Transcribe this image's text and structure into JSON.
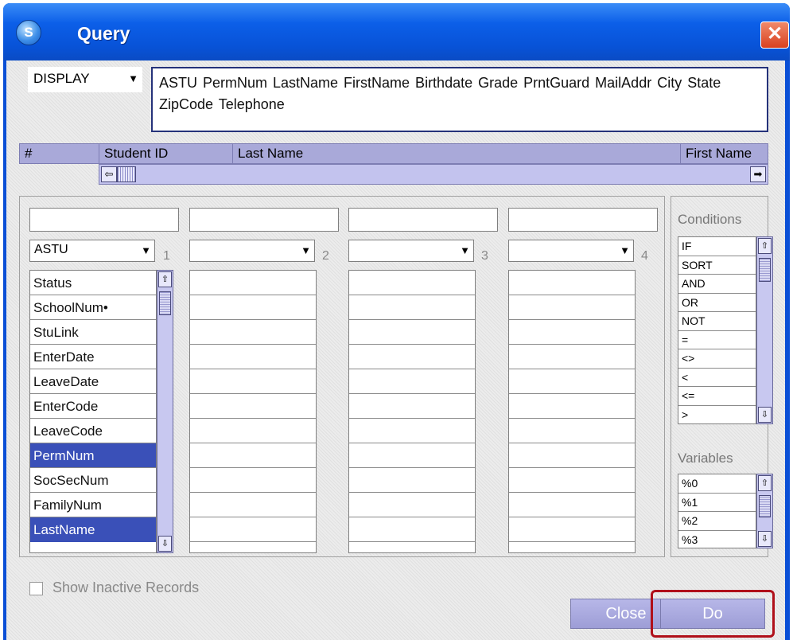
{
  "window": {
    "title": "Query",
    "icon_letter": "S",
    "close_glyph": "✕"
  },
  "display": {
    "mode": "DISPLAY",
    "fields_text": "ASTU PermNum LastName FirstName Birthdate Grade PrntGuard MailAddr City State ZipCode Telephone"
  },
  "grid": {
    "columns": [
      "#",
      "Student ID",
      "Last Name",
      "First Name"
    ],
    "scroll_left": "⇦",
    "scroll_right": "➡"
  },
  "builder": {
    "columns": [
      {
        "number": "1",
        "table": "ASTU"
      },
      {
        "number": "2",
        "table": ""
      },
      {
        "number": "3",
        "table": ""
      },
      {
        "number": "4",
        "table": ""
      }
    ],
    "fields": [
      "Status",
      "SchoolNum•",
      "StuLink",
      "EnterDate",
      "LeaveDate",
      "EnterCode",
      "LeaveCode",
      "PermNum",
      "SocSecNum",
      "FamilyNum",
      "LastName"
    ],
    "selected_fields": [
      "PermNum",
      "LastName"
    ]
  },
  "conditions": {
    "label": "Conditions",
    "items": [
      "IF",
      "SORT",
      "AND",
      "OR",
      "NOT",
      "=",
      "<>",
      "<",
      "<=",
      ">"
    ]
  },
  "variables": {
    "label": "Variables",
    "items": [
      "%0",
      "%1",
      "%2",
      "%3"
    ]
  },
  "footer": {
    "show_inactive_label": "Show Inactive Records",
    "show_inactive_checked": false,
    "close_label": "Close",
    "do_label": "Do"
  },
  "colors": {
    "titlebar": "#0853d8",
    "selection": "#3a50b8",
    "grid_header": "#a9a9d9",
    "highlight_frame": "#b0101a"
  }
}
